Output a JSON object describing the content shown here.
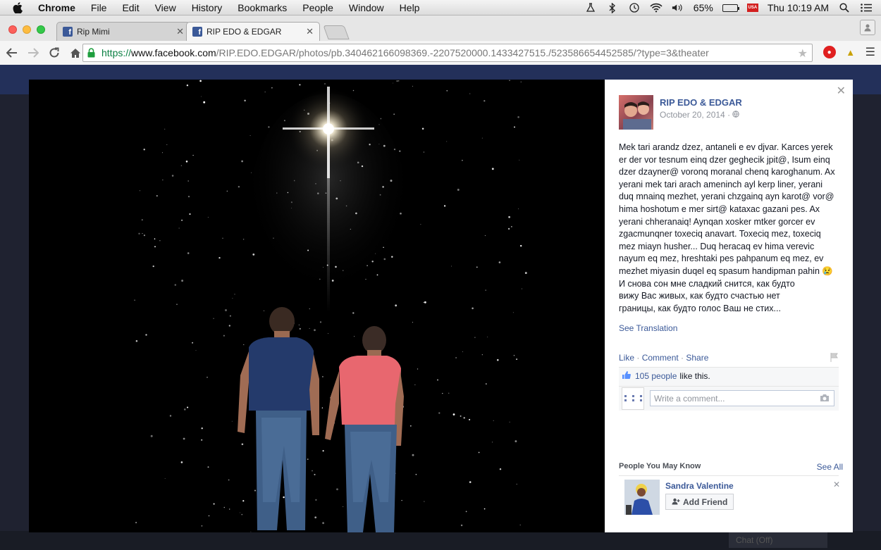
{
  "menubar": {
    "app_name": "Chrome",
    "menus": [
      "File",
      "Edit",
      "View",
      "History",
      "Bookmarks",
      "People",
      "Window",
      "Help"
    ],
    "battery_percent": "65%",
    "battery_level": 0.65,
    "keyboard_flag": "USA",
    "clock": "Thu 10:19 AM"
  },
  "browser": {
    "tabs": [
      {
        "title": "Rip Mimi",
        "icon": "facebook-favicon",
        "active": false
      },
      {
        "title": "RIP EDO & EDGAR",
        "icon": "facebook-favicon",
        "active": true
      }
    ],
    "url": {
      "scheme": "https://",
      "host": "www.facebook.com",
      "path": "/RIP.EDO.EDGAR/photos/pb.340462166098369.-2207520000.1433427515./523586654452585/?type=3&theater"
    }
  },
  "post": {
    "page_name": "RIP EDO & EDGAR",
    "date": "October 20, 2014 · ",
    "audience_icon": "globe-icon",
    "text": "Mek tari arandz dzez, antaneli e ev djvar. Karces yerek er der vor tesnum einq dzer geghecik jpit@, Isum einq dzer dzayner@ voronq moranal chenq karoghanum. Ax yerani mek tari arach ameninch ayl kerp liner, yerani duq mnainq mezhet, yerani chzgainq ayn karot@ vor@ hima hoshotum e mer sirt@ kataxac gazani pes. Ax yerani chheranaiq! Aynqan xosker mtker gorcer ev zgacmunqner toxeciq anavart. Toxeciq mez, toxeciq mez miayn husher... Duq heracaq ev hima verevic nayum eq mez, hreshtaki pes pahpanum eq mez, ev mezhet miyasin duqel eq spasum handipman pahin 😢\nИ снова сон мне сладкий снится, как будто\nвижу Вас живых, как будто счастью нет\nграницы, как будто голос Ваш не стих...",
    "see_translation": "See Translation",
    "actions": {
      "like": "Like",
      "comment": "Comment",
      "share": "Share"
    },
    "likes_count": "105 people",
    "likes_suffix": "like this.",
    "comment_placeholder": "Write a comment..."
  },
  "pymk": {
    "title": "People You May Know",
    "see_all": "See All",
    "person_name": "Sandra Valentine",
    "add_friend": "Add Friend"
  },
  "footer": {
    "chat_label": "Chat (Off)"
  },
  "colors": {
    "facebook_blue": "#3b5998",
    "theater_bg": "#000000",
    "shirt_navy": "#243a6b",
    "shirt_pink": "#e8676f"
  }
}
